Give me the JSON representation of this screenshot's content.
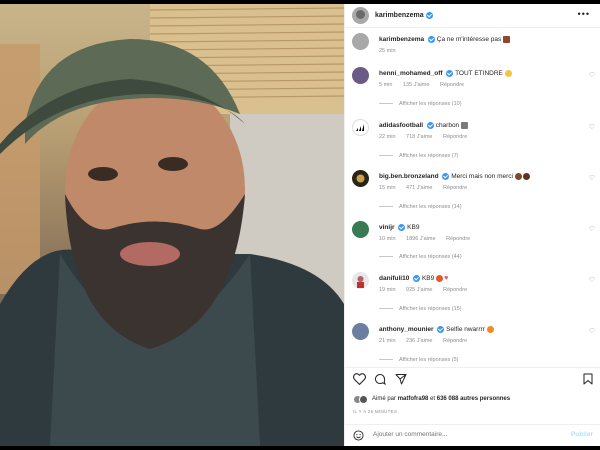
{
  "post": {
    "author": "karimbenzema",
    "photo_icon": "selfie-photo"
  },
  "caption": {
    "user": "karimbenzema",
    "text": "Ça ne m'intéresse pas",
    "time": "25 min"
  },
  "comments": [
    {
      "user": "henni_mohamed_off",
      "text": "TOUT ETINDRE",
      "time": "5 min",
      "likes": "135 J'aime",
      "reply": "Répondre",
      "view_replies": "Afficher les réponses (10)",
      "verified": true
    },
    {
      "user": "adidasfootball",
      "text": "charbon",
      "time": "22 min",
      "likes": "718 J'aime",
      "reply": "Répondre",
      "view_replies": "Afficher les réponses (7)",
      "verified": true
    },
    {
      "user": "big.ben.bronzeland",
      "text": "Merci mais non merci",
      "time": "15 min",
      "likes": "471 J'aime",
      "reply": "Répondre",
      "view_replies": "Afficher les réponses (14)",
      "verified": true
    },
    {
      "user": "vinijr",
      "text": "KB9",
      "time": "10 min",
      "likes": "1896 J'aime",
      "reply": "Répondre",
      "view_replies": "Afficher les réponses (44)",
      "verified": true
    },
    {
      "user": "danifuli10",
      "text": "KB9",
      "time": "19 min",
      "likes": "925 J'aime",
      "reply": "Répondre",
      "view_replies": "Afficher les réponses (15)",
      "verified": true
    },
    {
      "user": "anthony_mounier",
      "text": "Selfie nwarrrr",
      "time": "21 min",
      "likes": "236 J'aime",
      "reply": "Répondre",
      "view_replies": "Afficher les réponses (5)",
      "verified": true
    }
  ],
  "likes_line": {
    "prefix": "Aimé par",
    "user": "matfofra98",
    "middle": "et",
    "count": "636 088 autres personnes"
  },
  "time_ago": "IL Y A 25 MINUTES",
  "add_comment": {
    "placeholder": "Ajouter un commentaire...",
    "publish": "Publier"
  },
  "colors": {
    "verified": "#3897f0",
    "link": "#b2dffc",
    "muted": "#8e8e8e"
  }
}
